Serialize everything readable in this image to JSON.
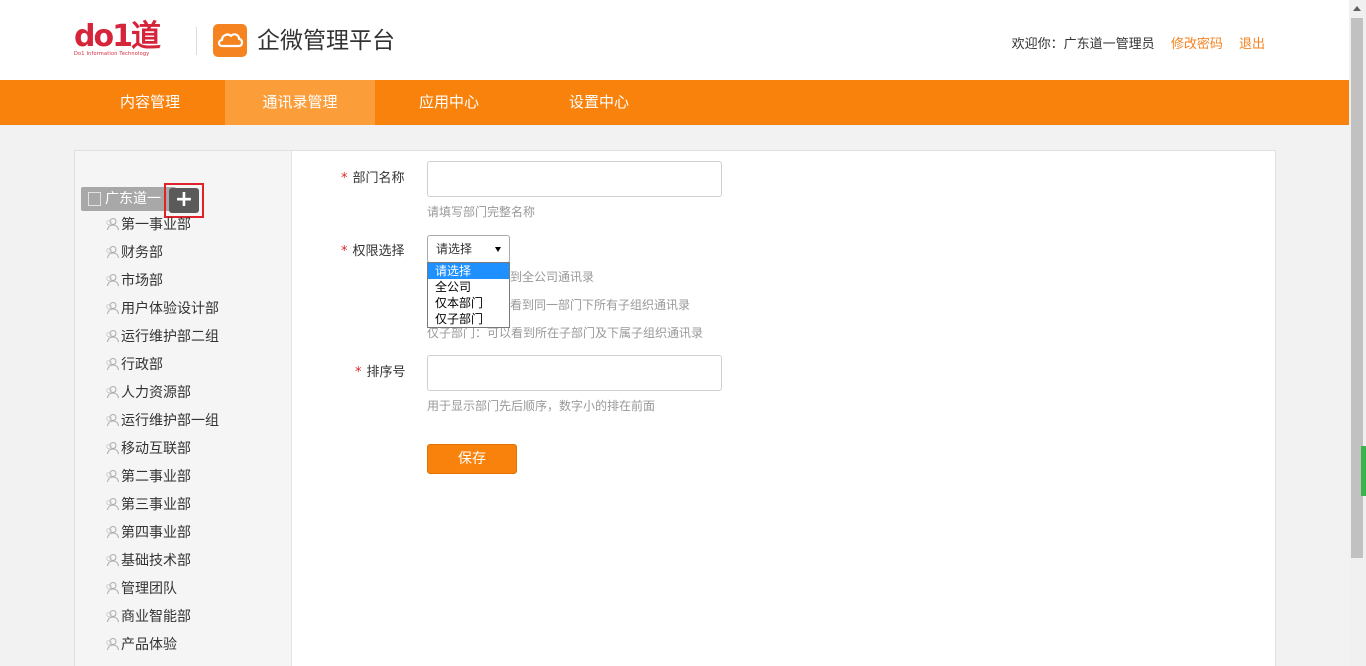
{
  "header": {
    "logo_text": "do1道",
    "logo_subtext": "Do1 Information Technology",
    "app_title": "企微管理平台",
    "welcome": "欢迎你：广东道一管理员",
    "change_password": "修改密码",
    "logout": "退出"
  },
  "nav": {
    "items": [
      {
        "label": "内容管理",
        "active": false
      },
      {
        "label": "通讯录管理",
        "active": true
      },
      {
        "label": "应用中心",
        "active": false
      },
      {
        "label": "设置中心",
        "active": false
      }
    ],
    "accent": "#f8820b",
    "active_color": "#fb9e3a"
  },
  "sidebar": {
    "root": "广东道一",
    "add_icon": "+",
    "items": [
      "第一事业部",
      "财务部",
      "市场部",
      "用户体验设计部",
      "运行维护部二组",
      "行政部",
      "人力资源部",
      "运行维护部一组",
      "移动互联部",
      "第二事业部",
      "第三事业部",
      "第四事业部",
      "基础技术部",
      "管理团队",
      "商业智能部",
      "产品体验"
    ]
  },
  "form": {
    "dept_name_label": "部门名称",
    "dept_name_value": "",
    "dept_name_hint": "请填写部门完整名称",
    "permission_label": "权限选择",
    "permission_selected": "请选择",
    "permission_options": [
      "请选择",
      "全公司",
      "仅本部门",
      "仅子部门"
    ],
    "permission_hint_1_visible": "到全公司通讯录",
    "permission_hint_2_visible": "看到同一部门下所有子组织通讯录",
    "permission_hint_3": "仅子部门：可以看到所在子部门及下属子组织通讯录",
    "sort_label": "排序号",
    "sort_value": "",
    "sort_hint": "用于显示部门先后顺序，数字小的排在前面",
    "required_mark": "*",
    "save_label": "保存"
  }
}
